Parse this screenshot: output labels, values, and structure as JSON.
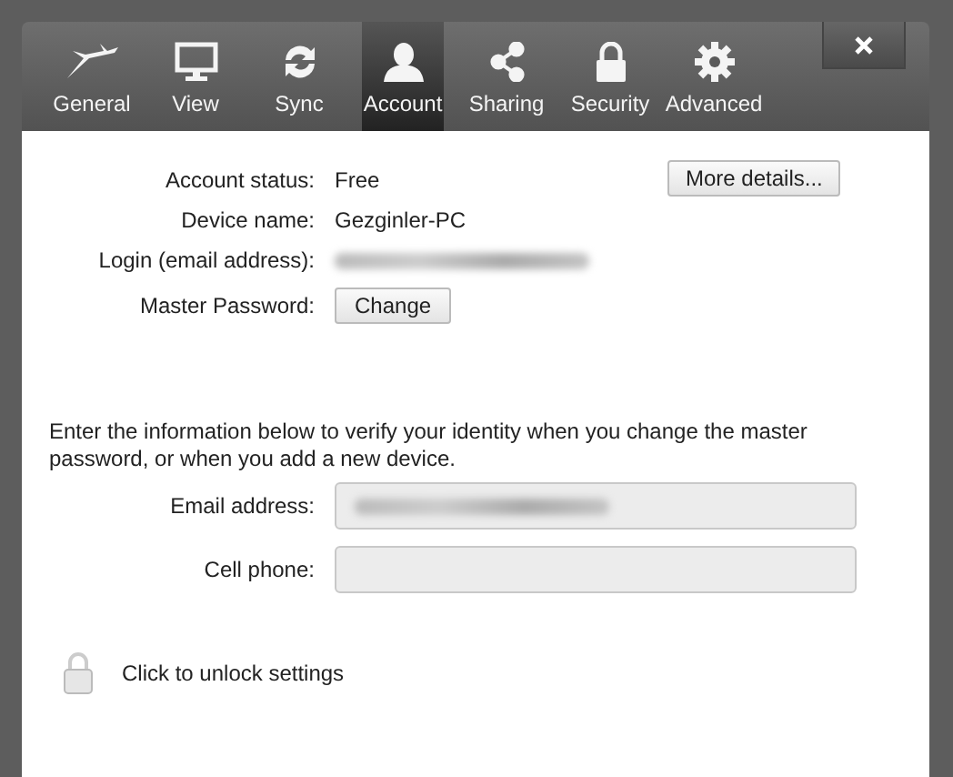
{
  "tabs": [
    {
      "label": "General",
      "selected": false
    },
    {
      "label": "View",
      "selected": false
    },
    {
      "label": "Sync",
      "selected": false
    },
    {
      "label": "Account",
      "selected": true
    },
    {
      "label": "Sharing",
      "selected": false
    },
    {
      "label": "Security",
      "selected": false
    },
    {
      "label": "Advanced",
      "selected": false
    }
  ],
  "account": {
    "rows": [
      {
        "label": "Account status:",
        "value": "Free"
      },
      {
        "label": "Device name:",
        "value": "Gezginler-PC"
      },
      {
        "label": "Login (email address):",
        "redacted": true
      },
      {
        "label": "Master Password:",
        "button": "Change"
      }
    ],
    "more_button": "More details..."
  },
  "verify": {
    "text": "Enter the information below to verify your identity when you change the master password, or when you add a new device.",
    "fields": [
      {
        "label": "Email address:",
        "redacted": true,
        "disabled": true
      },
      {
        "label": "Cell phone:",
        "redacted": false,
        "disabled": true
      }
    ]
  },
  "lock": {
    "text": "Click to unlock settings",
    "locked": true
  }
}
